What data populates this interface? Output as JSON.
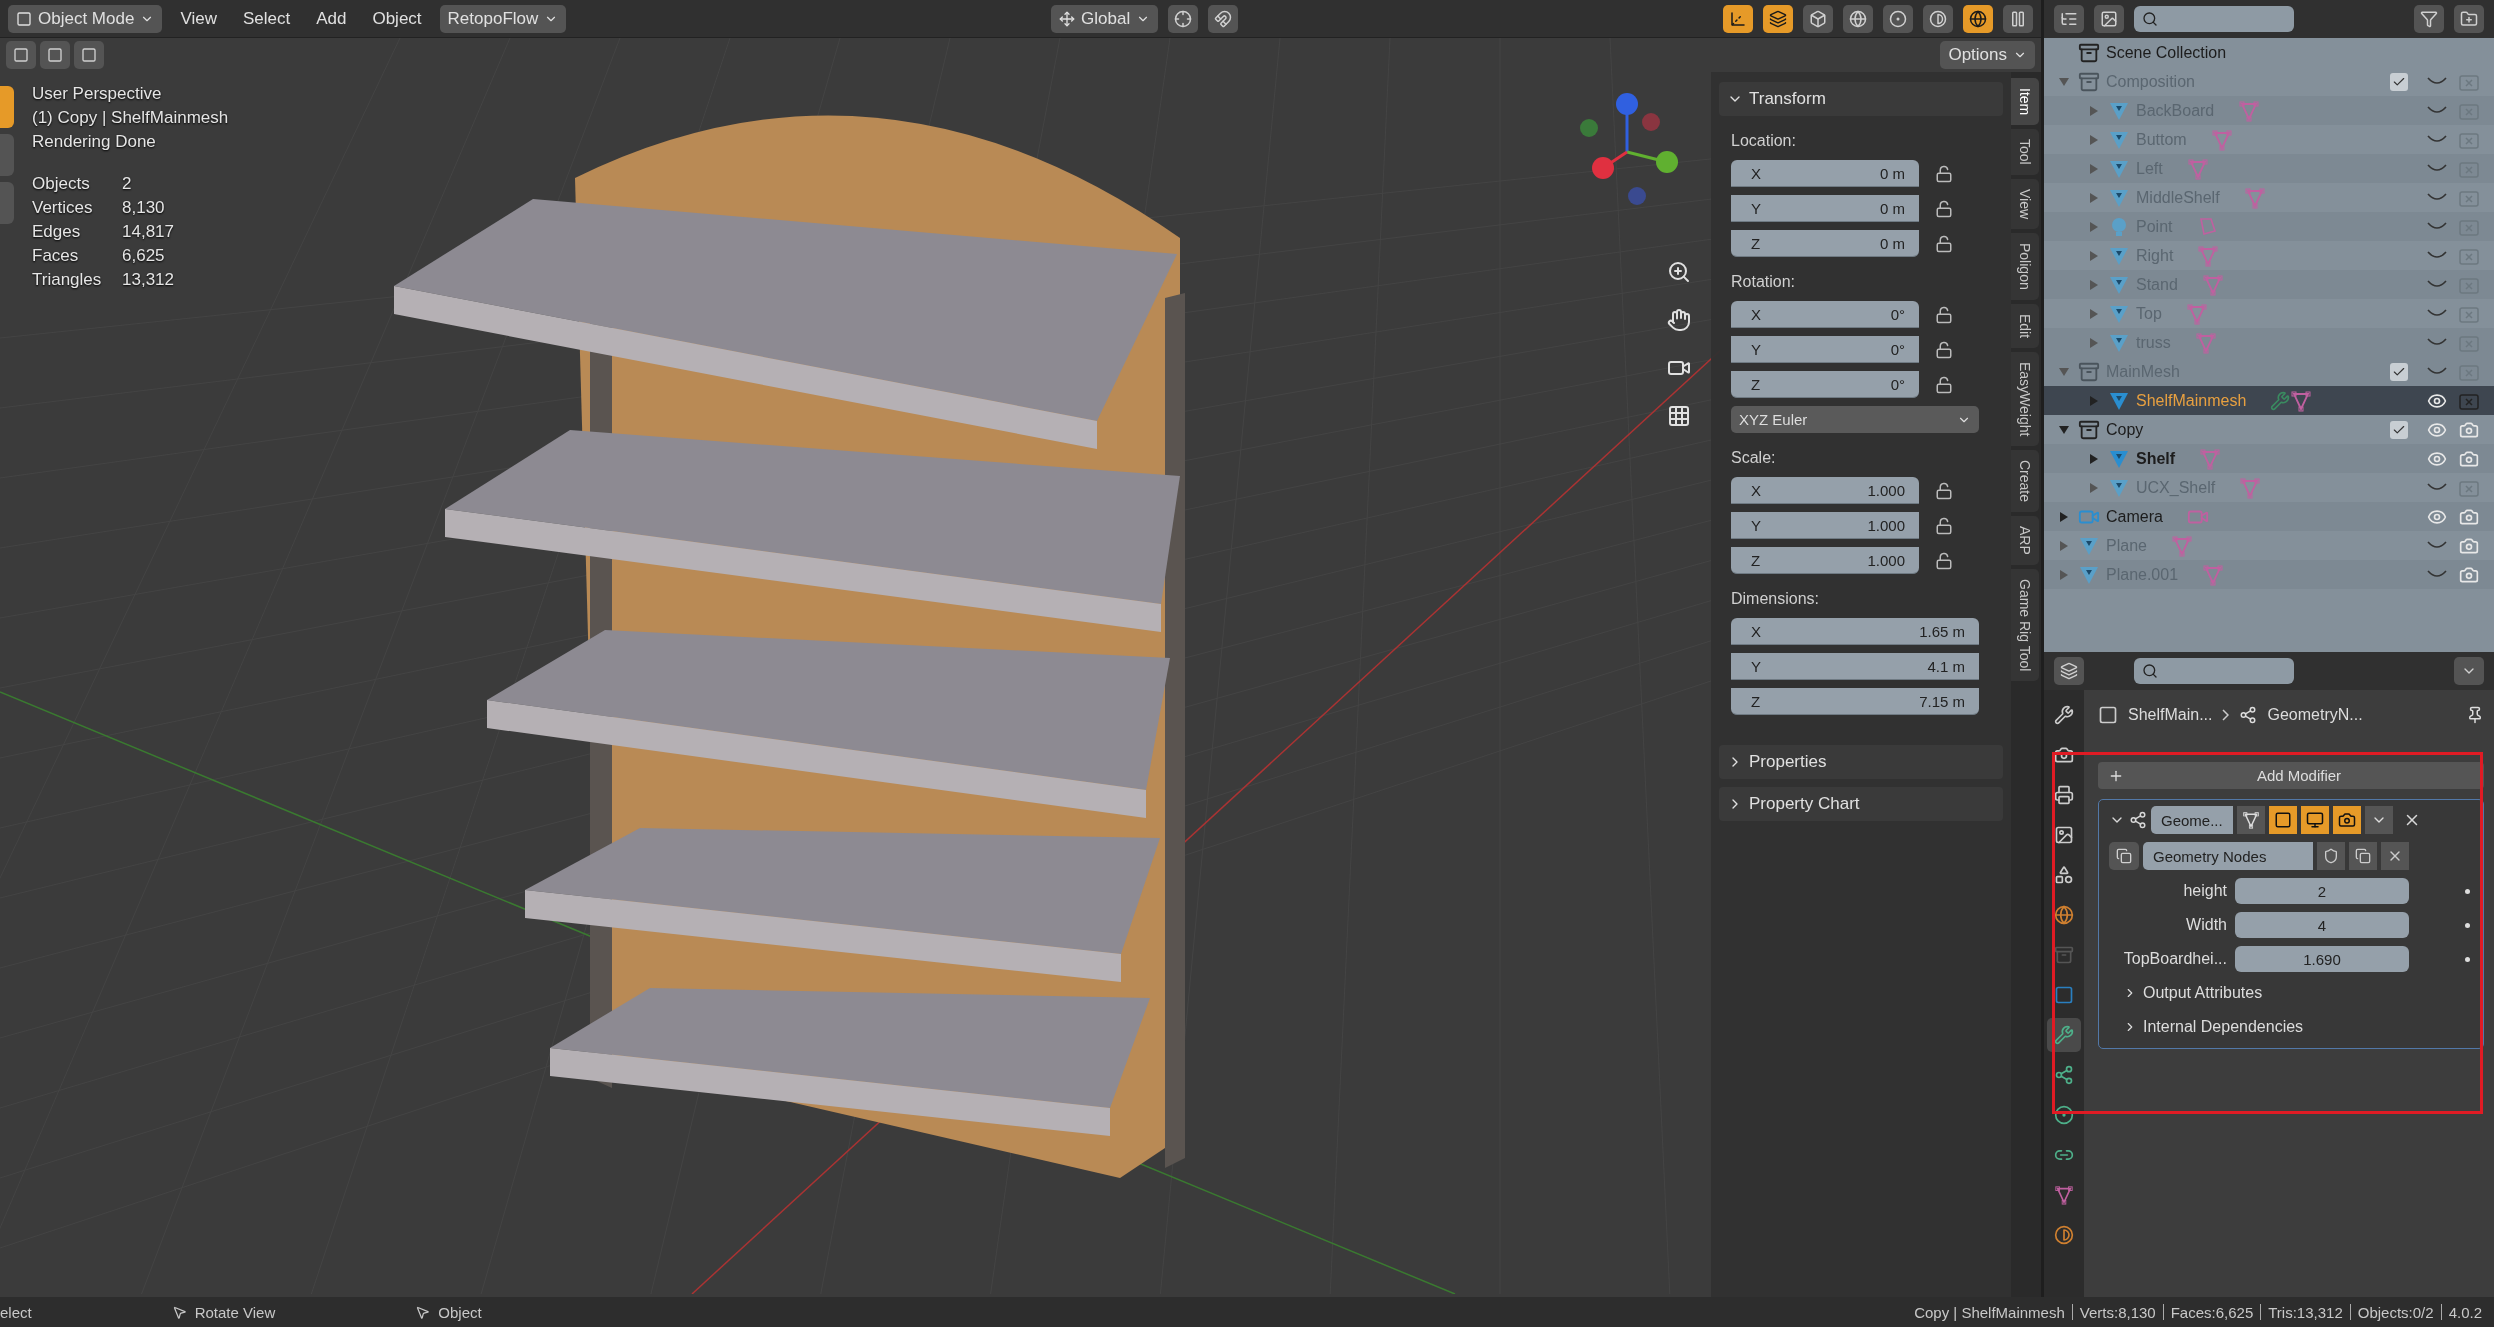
{
  "header": {
    "mode_menu": "Object Mode",
    "menus": [
      "View",
      "Select",
      "Add",
      "Object"
    ],
    "addon_menu": "RetopoFlow",
    "orientation": "Global",
    "toggles": [
      {
        "kind": "gizmos",
        "on": true
      },
      {
        "kind": "overlays",
        "on": true
      },
      {
        "kind": "xray",
        "on": false
      }
    ],
    "shading_modes": [
      {
        "kind": "wireframe",
        "selected": false
      },
      {
        "kind": "solid",
        "selected": false
      },
      {
        "kind": "material",
        "selected": false
      },
      {
        "kind": "rendered",
        "selected": true
      }
    ]
  },
  "tool_header": {
    "options_button": "Options"
  },
  "tools": [
    {
      "selected": true
    },
    {
      "selected": false
    },
    {
      "selected": false
    }
  ],
  "viewport_info": {
    "lines": [
      "User Perspective",
      "(1) Copy | ShelfMainmesh",
      "Rendering Done"
    ],
    "stats": [
      {
        "label": "Objects",
        "value": "2"
      },
      {
        "label": "Vertices",
        "value": "8,130"
      },
      {
        "label": "Edges",
        "value": "14,817"
      },
      {
        "label": "Faces",
        "value": "6,625"
      },
      {
        "label": "Triangles",
        "value": "13,312"
      }
    ]
  },
  "n_panel": {
    "transform": {
      "title": "Transform",
      "expanded": true,
      "rotation_mode": "XYZ Euler",
      "groups": [
        {
          "label": "Location:",
          "lockable": true,
          "fields": [
            {
              "axis": "X",
              "value": "0 m"
            },
            {
              "axis": "Y",
              "value": "0 m"
            },
            {
              "axis": "Z",
              "value": "0 m"
            }
          ]
        },
        {
          "label": "Rotation:",
          "lockable": true,
          "fields": [
            {
              "axis": "X",
              "value": "0°"
            },
            {
              "axis": "Y",
              "value": "0°"
            },
            {
              "axis": "Z",
              "value": "0°"
            }
          ]
        },
        {
          "label": "Scale:",
          "lockable": true,
          "fields": [
            {
              "axis": "X",
              "value": "1.000"
            },
            {
              "axis": "Y",
              "value": "1.000"
            },
            {
              "axis": "Z",
              "value": "1.000"
            }
          ]
        },
        {
          "label": "Dimensions:",
          "lockable": false,
          "fields": [
            {
              "axis": "X",
              "value": "1.65 m"
            },
            {
              "axis": "Y",
              "value": "4.1 m"
            },
            {
              "axis": "Z",
              "value": "7.15 m"
            }
          ]
        }
      ]
    },
    "panels": [
      {
        "title": "Properties",
        "expanded": false
      },
      {
        "title": "Property Chart",
        "expanded": false
      }
    ],
    "tabs": [
      {
        "label": "Item",
        "selected": true
      },
      {
        "label": "Tool",
        "selected": false
      },
      {
        "label": "View",
        "selected": false
      },
      {
        "label": "Poligon",
        "selected": false
      },
      {
        "label": "Edit",
        "selected": false
      },
      {
        "label": "EasyWeight",
        "selected": false
      },
      {
        "label": "Create",
        "selected": false
      },
      {
        "label": "ARP",
        "selected": false
      },
      {
        "label": "Game Rig Tool",
        "selected": false
      }
    ]
  },
  "outliner": {
    "root": "Scene Collection",
    "items": [
      {
        "name": "Composition",
        "kind": "collection",
        "expanded": true,
        "checked": true,
        "visible": false,
        "renderable": false,
        "selected": false,
        "children": [
          {
            "name": "BackBoard",
            "kind": "mesh",
            "expanded": false,
            "visible": false,
            "renderable": false,
            "selected": false,
            "modifier": false
          },
          {
            "name": "Buttom",
            "kind": "mesh",
            "expanded": false,
            "visible": false,
            "renderable": false,
            "selected": false,
            "modifier": false
          },
          {
            "name": "Left",
            "kind": "mesh",
            "expanded": false,
            "visible": false,
            "renderable": false,
            "selected": false,
            "modifier": false
          },
          {
            "name": "MiddleShelf",
            "kind": "mesh",
            "expanded": false,
            "visible": false,
            "renderable": false,
            "selected": false,
            "modifier": false
          },
          {
            "name": "Point",
            "kind": "light",
            "expanded": false,
            "visible": false,
            "renderable": false,
            "selected": false,
            "modifier": false
          },
          {
            "name": "Right",
            "kind": "mesh",
            "expanded": false,
            "visible": false,
            "renderable": false,
            "selected": false,
            "modifier": false
          },
          {
            "name": "Stand",
            "kind": "mesh",
            "expanded": false,
            "visible": false,
            "renderable": false,
            "selected": false,
            "modifier": false
          },
          {
            "name": "Top",
            "kind": "mesh",
            "expanded": false,
            "visible": false,
            "renderable": false,
            "selected": false,
            "modifier": false
          },
          {
            "name": "truss",
            "kind": "mesh",
            "expanded": false,
            "visible": false,
            "renderable": false,
            "selected": false,
            "modifier": false
          }
        ]
      },
      {
        "name": "MainMesh",
        "kind": "collection",
        "expanded": true,
        "checked": true,
        "visible": false,
        "renderable": false,
        "selected": false,
        "children": [
          {
            "name": "ShelfMainmesh",
            "kind": "mesh",
            "expanded": false,
            "visible": true,
            "renderable": false,
            "selected": true,
            "modifier": true
          }
        ]
      },
      {
        "name": "Copy",
        "kind": "collection",
        "expanded": true,
        "checked": true,
        "visible": true,
        "renderable": true,
        "selected": false,
        "children": [
          {
            "name": "Shelf",
            "kind": "mesh",
            "expanded": false,
            "visible": true,
            "renderable": true,
            "selected": false,
            "modifier": false
          },
          {
            "name": "UCX_Shelf",
            "kind": "mesh",
            "expanded": false,
            "visible": false,
            "renderable": false,
            "selected": false,
            "modifier": false
          }
        ]
      },
      {
        "name": "Camera",
        "kind": "camera",
        "expanded": false,
        "visible": true,
        "renderable": true,
        "selected": false,
        "modifier": false
      },
      {
        "name": "Plane",
        "kind": "mesh",
        "expanded": false,
        "visible": false,
        "renderable": true,
        "selected": false,
        "modifier": false
      },
      {
        "name": "Plane.001",
        "kind": "mesh",
        "expanded": false,
        "visible": false,
        "renderable": true,
        "selected": false,
        "modifier": false
      }
    ]
  },
  "properties": {
    "breadcrumb": [
      "ShelfMain...",
      "GeometryN..."
    ],
    "tabs": [
      {
        "kind": "tool",
        "selected": false
      },
      {
        "kind": "render",
        "selected": false
      },
      {
        "kind": "output",
        "selected": false
      },
      {
        "kind": "view_layer",
        "selected": false
      },
      {
        "kind": "scene",
        "selected": false
      },
      {
        "kind": "world",
        "selected": false
      },
      {
        "kind": "collection",
        "selected": false
      },
      {
        "kind": "object",
        "selected": false
      },
      {
        "kind": "modifiers",
        "selected": true
      },
      {
        "kind": "particles",
        "selected": false
      },
      {
        "kind": "physics",
        "selected": false
      },
      {
        "kind": "constraints",
        "selected": false
      },
      {
        "kind": "data",
        "selected": false
      },
      {
        "kind": "material",
        "selected": false
      }
    ],
    "add_modifier": "Add Modifier",
    "modifier": {
      "name": "Geome...",
      "expanded": true,
      "toggles": [
        {
          "kind": "on_cage",
          "on": false
        },
        {
          "kind": "edit_mode",
          "on": true
        },
        {
          "kind": "viewport",
          "on": true
        },
        {
          "kind": "render",
          "on": true
        }
      ],
      "node_group": "Geometry Nodes",
      "inputs": [
        {
          "label": "height",
          "value": "2"
        },
        {
          "label": "Width",
          "value": "4"
        },
        {
          "label": "TopBoardhei...",
          "value": "1.690"
        }
      ],
      "subpanels": [
        {
          "title": "Output Attributes",
          "expanded": false
        },
        {
          "title": "Internal Dependencies",
          "expanded": false
        }
      ]
    }
  },
  "status_bar": {
    "hints": [
      "elect",
      "Rotate View",
      "Object"
    ],
    "info": [
      "Copy | ShelfMainmesh",
      "Verts:8,130",
      "Faces:6,625",
      "Tris:13,312",
      "Objects:0/2",
      "4.0.2"
    ]
  }
}
